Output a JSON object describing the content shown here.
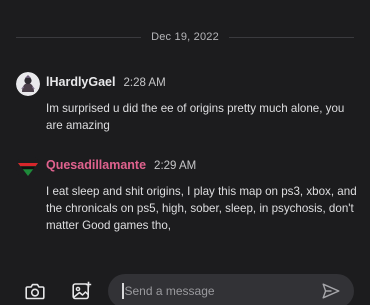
{
  "chat": {
    "date_divider": "Dec 19, 2022",
    "messages": [
      {
        "username": "lHardlyGael",
        "timestamp": "2:28 AM",
        "text": "Im surprised u did the ee of origins pretty much alone, you are amazing",
        "username_color": "#e8e8ea"
      },
      {
        "username": "Quesadillamante",
        "timestamp": "2:29 AM",
        "text": "I eat sleep and shit origins, I play this map on ps3, xbox, and the chronicals on ps5, high, sober, sleep, in psychosis, don't matter Good games tho,",
        "username_color": "#e0628e"
      }
    ]
  },
  "composer": {
    "placeholder": "Send a message",
    "icons": [
      "camera-icon",
      "gallery-icon",
      "send-icon"
    ]
  },
  "colors": {
    "background": "#1c1c1e",
    "input_background": "#323236",
    "accent_username": "#e0628e"
  }
}
